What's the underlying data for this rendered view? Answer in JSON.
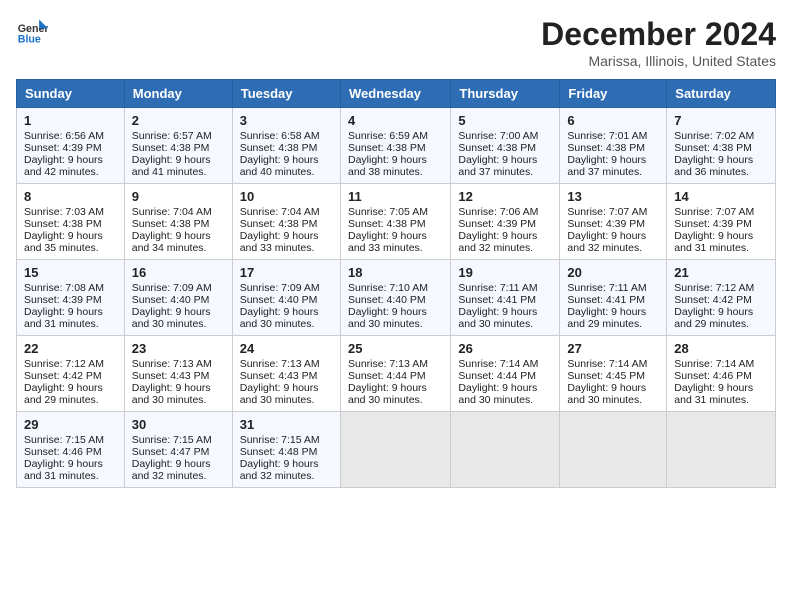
{
  "header": {
    "logo_general": "General",
    "logo_blue": "Blue",
    "month_title": "December 2024",
    "location": "Marissa, Illinois, United States"
  },
  "days_of_week": [
    "Sunday",
    "Monday",
    "Tuesday",
    "Wednesday",
    "Thursday",
    "Friday",
    "Saturday"
  ],
  "weeks": [
    [
      {
        "day": "1",
        "sunrise": "6:56 AM",
        "sunset": "4:39 PM",
        "daylight": "9 hours and 42 minutes."
      },
      {
        "day": "2",
        "sunrise": "6:57 AM",
        "sunset": "4:38 PM",
        "daylight": "9 hours and 41 minutes."
      },
      {
        "day": "3",
        "sunrise": "6:58 AM",
        "sunset": "4:38 PM",
        "daylight": "9 hours and 40 minutes."
      },
      {
        "day": "4",
        "sunrise": "6:59 AM",
        "sunset": "4:38 PM",
        "daylight": "9 hours and 38 minutes."
      },
      {
        "day": "5",
        "sunrise": "7:00 AM",
        "sunset": "4:38 PM",
        "daylight": "9 hours and 37 minutes."
      },
      {
        "day": "6",
        "sunrise": "7:01 AM",
        "sunset": "4:38 PM",
        "daylight": "9 hours and 37 minutes."
      },
      {
        "day": "7",
        "sunrise": "7:02 AM",
        "sunset": "4:38 PM",
        "daylight": "9 hours and 36 minutes."
      }
    ],
    [
      {
        "day": "8",
        "sunrise": "7:03 AM",
        "sunset": "4:38 PM",
        "daylight": "9 hours and 35 minutes."
      },
      {
        "day": "9",
        "sunrise": "7:04 AM",
        "sunset": "4:38 PM",
        "daylight": "9 hours and 34 minutes."
      },
      {
        "day": "10",
        "sunrise": "7:04 AM",
        "sunset": "4:38 PM",
        "daylight": "9 hours and 33 minutes."
      },
      {
        "day": "11",
        "sunrise": "7:05 AM",
        "sunset": "4:38 PM",
        "daylight": "9 hours and 33 minutes."
      },
      {
        "day": "12",
        "sunrise": "7:06 AM",
        "sunset": "4:39 PM",
        "daylight": "9 hours and 32 minutes."
      },
      {
        "day": "13",
        "sunrise": "7:07 AM",
        "sunset": "4:39 PM",
        "daylight": "9 hours and 32 minutes."
      },
      {
        "day": "14",
        "sunrise": "7:07 AM",
        "sunset": "4:39 PM",
        "daylight": "9 hours and 31 minutes."
      }
    ],
    [
      {
        "day": "15",
        "sunrise": "7:08 AM",
        "sunset": "4:39 PM",
        "daylight": "9 hours and 31 minutes."
      },
      {
        "day": "16",
        "sunrise": "7:09 AM",
        "sunset": "4:40 PM",
        "daylight": "9 hours and 30 minutes."
      },
      {
        "day": "17",
        "sunrise": "7:09 AM",
        "sunset": "4:40 PM",
        "daylight": "9 hours and 30 minutes."
      },
      {
        "day": "18",
        "sunrise": "7:10 AM",
        "sunset": "4:40 PM",
        "daylight": "9 hours and 30 minutes."
      },
      {
        "day": "19",
        "sunrise": "7:11 AM",
        "sunset": "4:41 PM",
        "daylight": "9 hours and 30 minutes."
      },
      {
        "day": "20",
        "sunrise": "7:11 AM",
        "sunset": "4:41 PM",
        "daylight": "9 hours and 29 minutes."
      },
      {
        "day": "21",
        "sunrise": "7:12 AM",
        "sunset": "4:42 PM",
        "daylight": "9 hours and 29 minutes."
      }
    ],
    [
      {
        "day": "22",
        "sunrise": "7:12 AM",
        "sunset": "4:42 PM",
        "daylight": "9 hours and 29 minutes."
      },
      {
        "day": "23",
        "sunrise": "7:13 AM",
        "sunset": "4:43 PM",
        "daylight": "9 hours and 30 minutes."
      },
      {
        "day": "24",
        "sunrise": "7:13 AM",
        "sunset": "4:43 PM",
        "daylight": "9 hours and 30 minutes."
      },
      {
        "day": "25",
        "sunrise": "7:13 AM",
        "sunset": "4:44 PM",
        "daylight": "9 hours and 30 minutes."
      },
      {
        "day": "26",
        "sunrise": "7:14 AM",
        "sunset": "4:44 PM",
        "daylight": "9 hours and 30 minutes."
      },
      {
        "day": "27",
        "sunrise": "7:14 AM",
        "sunset": "4:45 PM",
        "daylight": "9 hours and 30 minutes."
      },
      {
        "day": "28",
        "sunrise": "7:14 AM",
        "sunset": "4:46 PM",
        "daylight": "9 hours and 31 minutes."
      }
    ],
    [
      {
        "day": "29",
        "sunrise": "7:15 AM",
        "sunset": "4:46 PM",
        "daylight": "9 hours and 31 minutes."
      },
      {
        "day": "30",
        "sunrise": "7:15 AM",
        "sunset": "4:47 PM",
        "daylight": "9 hours and 32 minutes."
      },
      {
        "day": "31",
        "sunrise": "7:15 AM",
        "sunset": "4:48 PM",
        "daylight": "9 hours and 32 minutes."
      },
      null,
      null,
      null,
      null
    ]
  ]
}
